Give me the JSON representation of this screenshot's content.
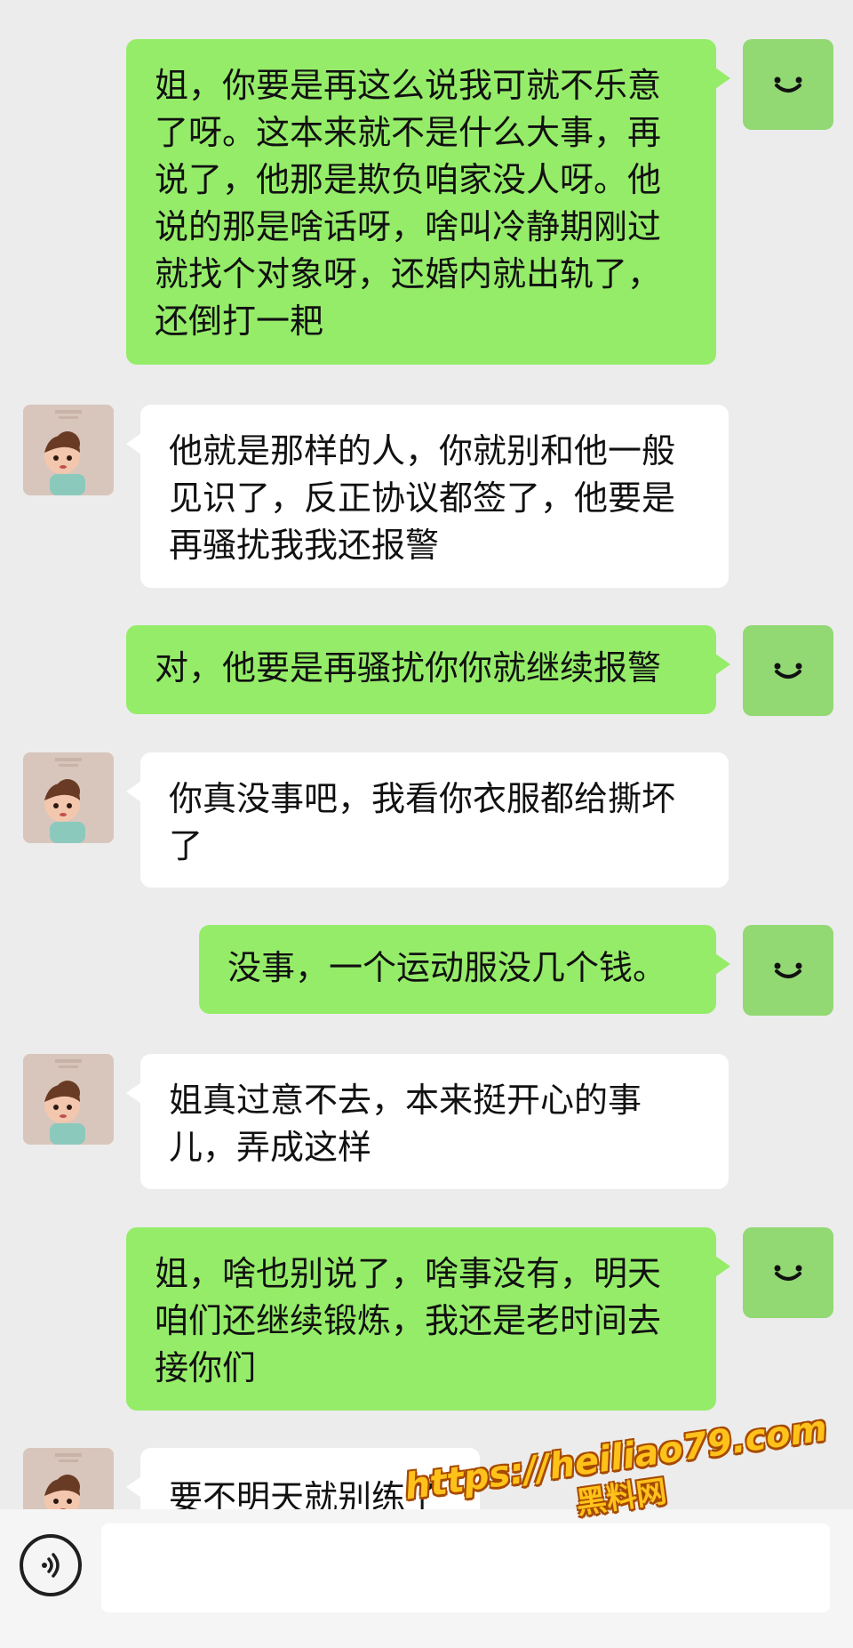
{
  "messages": [
    {
      "side": "me",
      "text": "姐，你要是再这么说我可就不乐意\n了呀。这本来就不是什么大事，再\n说了，他那是欺负咱家没人呀。他\n说的那是啥话呀，啥叫冷静期刚过\n就找个对象呀，还婚内就出轨了，\n还倒打一耙"
    },
    {
      "side": "other",
      "text": "他就是那样的人，你就别和他一般\n见识了，反正协议都签了，他要是\n再骚扰我我还报警"
    },
    {
      "side": "me",
      "text": "对，他要是再骚扰你你就继续报警"
    },
    {
      "side": "other",
      "text": "你真没事吧，我看你衣服都给撕坏\n了"
    },
    {
      "side": "me",
      "text": "没事，一个运动服没几个钱。"
    },
    {
      "side": "other",
      "text": "姐真过意不去，本来挺开心的事\n儿，弄成这样"
    },
    {
      "side": "me",
      "text": "姐，啥也别说了，啥事没有，明天\n咱们还继续锻炼，我还是老时间去\n接你们"
    },
    {
      "side": "other",
      "text": "要不明天就别练了"
    }
  ],
  "input_bar": {
    "voice_icon": "voice-icon",
    "text_value": ""
  },
  "watermark": {
    "url": "https://heiliao79.com",
    "name": "黑料网"
  },
  "colors": {
    "background": "#ececec",
    "my_bubble": "#95ec69",
    "other_bubble": "#ffffff",
    "my_avatar": "#92d873",
    "watermark_fill": "#ffc21a"
  }
}
